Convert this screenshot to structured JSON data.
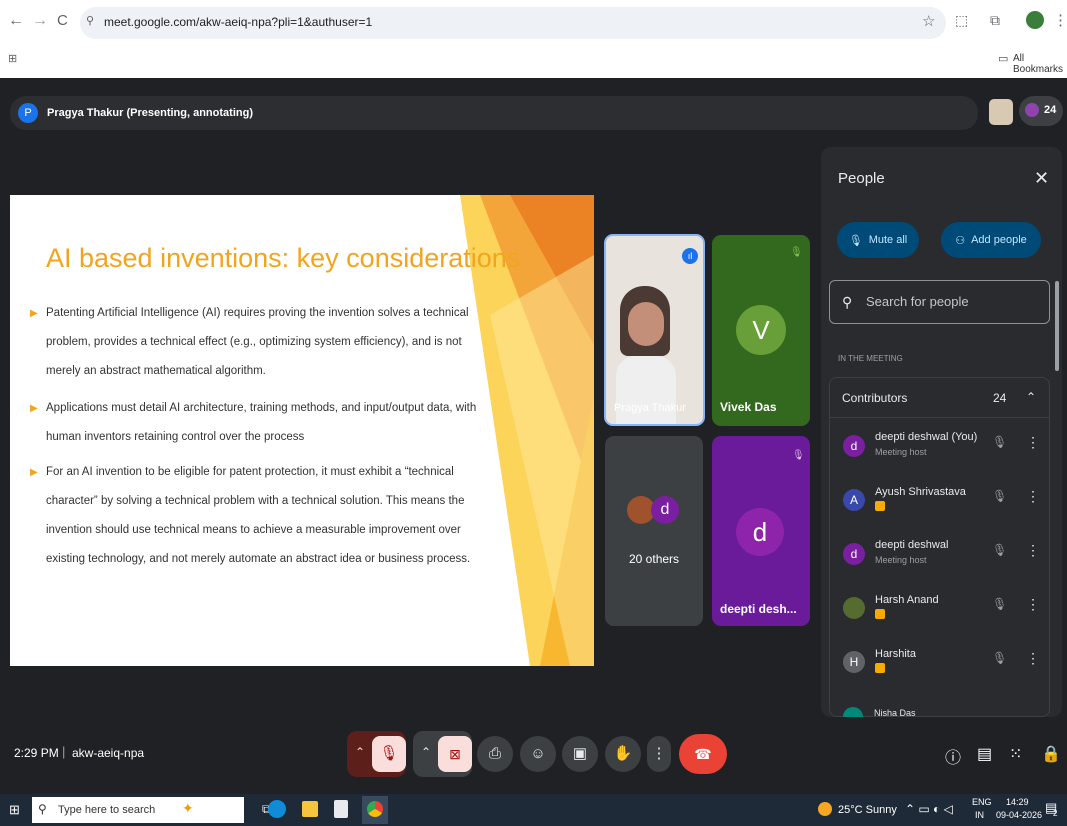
{
  "browser": {
    "url": "meet.google.com/akw-aeiq-npa?pli=1&authuser=1",
    "bookmarks_label": "All Bookmarks"
  },
  "presenting": {
    "avatar_letter": "P",
    "text": "Pragya Thakur (Presenting, annotating)",
    "participant_count": "24"
  },
  "slide": {
    "title": "AI based inventions: key considerations",
    "bullets": [
      "Patenting Artificial Intelligence (AI) requires proving the invention solves a technical problem, provides a technical effect (e.g., optimizing system efficiency), and is not merely an abstract mathematical algorithm.",
      "Applications must detail AI architecture, training methods, and input/output data, with human inventors retaining control over the process",
      "For an AI invention to be eligible for patent protection, it must exhibit a “technical character” by solving a technical problem with a technical solution. This means the invention should use technical means to achieve a measurable improvement over existing technology, and not merely automate an abstract idea or business process."
    ]
  },
  "tiles": {
    "pragya": "Pragya Thakur",
    "vivek_letter": "V",
    "vivek": "Vivek Das",
    "others_letter": "d",
    "others": "20 others",
    "deepti_letter": "d",
    "deepti": "deepti desh..."
  },
  "people_panel": {
    "title": "People",
    "mute_all": "Mute all",
    "add_people": "Add people",
    "search_placeholder": "Search for people",
    "section": "IN THE MEETING",
    "group": "Contributors",
    "group_count": "24",
    "members": [
      {
        "letter": "d",
        "name": "deepti deshwal (You)",
        "sub": "Meeting host",
        "color": "#7b1fa2"
      },
      {
        "letter": "A",
        "name": "Ayush Shrivastava",
        "sub": "",
        "color": "#3949ab"
      },
      {
        "letter": "d",
        "name": "deepti deshwal",
        "sub": "Meeting host",
        "color": "#7b1fa2"
      },
      {
        "letter": "",
        "name": "Harsh Anand",
        "sub": "",
        "color": "#556b2f"
      },
      {
        "letter": "H",
        "name": "Harshita",
        "sub": "",
        "color": "#5f6368"
      }
    ],
    "partial_member": "Nisha Das"
  },
  "meeting_bar": {
    "time": "2:29 PM",
    "code": "akw-aeiq-npa"
  },
  "taskbar": {
    "search": "Type here to search",
    "weather": "25°C  Sunny",
    "lang1": "ENG",
    "lang2": "IN",
    "time": "14:29",
    "date": "09-04-2026",
    "notif_count": "2"
  },
  "colors": {
    "accent_orange": "#f2a51c",
    "end_call": "#ea4335",
    "meet_bg": "#202124"
  }
}
